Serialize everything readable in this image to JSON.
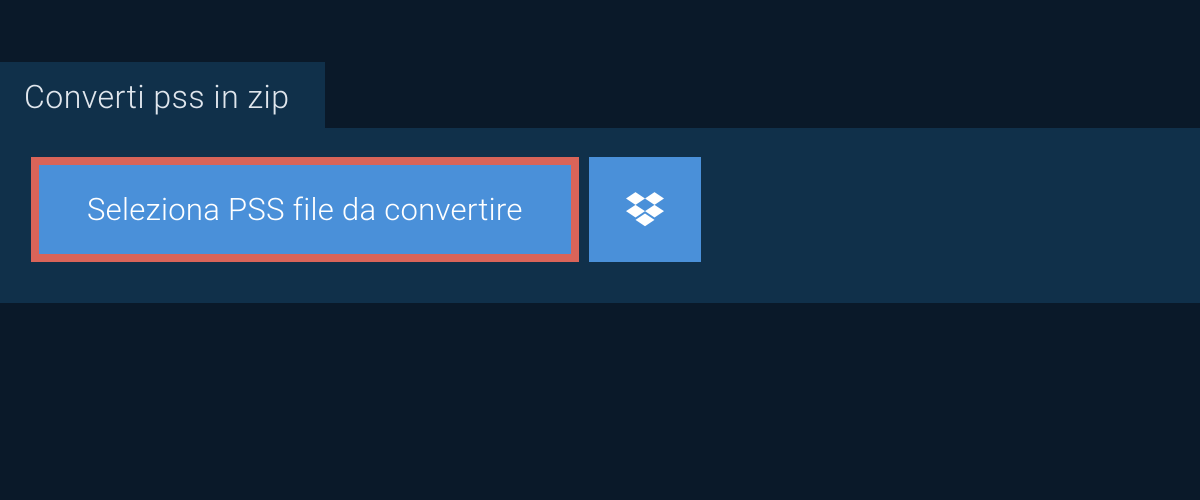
{
  "tab": {
    "title": "Converti pss in zip"
  },
  "actions": {
    "select_label": "Seleziona PSS file da convertire"
  },
  "colors": {
    "background_dark": "#0a1929",
    "panel": "#10304a",
    "button": "#4a90d9",
    "highlight_border": "#d96459",
    "text_light": "#e0e6ed"
  }
}
